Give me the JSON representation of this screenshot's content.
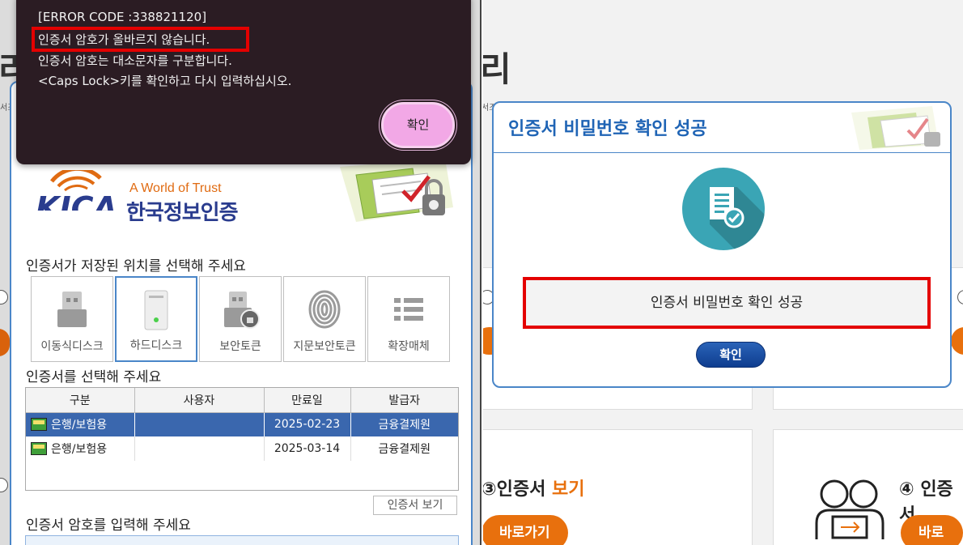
{
  "left": {
    "background": {
      "big_char": "리",
      "crumb": "서조"
    },
    "error_dialog": {
      "code_line": "[ERROR CODE :338821120]",
      "message_highlight": "인증서 암호가 올바르지 않습니다.",
      "message_2": "인증서 암호는 대소문자를 구분합니다.",
      "message_3": "<Caps Lock>키를 확인하고 다시 입력하십시오.",
      "ok_label": "확인"
    },
    "kica": {
      "logo_text": "KICA",
      "tagline": "A World of Trust",
      "name": "한국정보인증",
      "storage_title": "인증서가 저장된 위치를 선택해 주세요",
      "storage_options": [
        {
          "label": "이동식디스크",
          "icon": "usb-drive-icon",
          "selected": false
        },
        {
          "label": "하드디스크",
          "icon": "hard-disk-icon",
          "selected": true
        },
        {
          "label": "보안토큰",
          "icon": "security-token-icon",
          "selected": false
        },
        {
          "label": "지문보안토큰",
          "icon": "fingerprint-icon",
          "selected": false
        },
        {
          "label": "확장매체",
          "icon": "list-icon",
          "selected": false
        }
      ],
      "select_title": "인증서를 선택해 주세요",
      "table": {
        "headers": [
          "구분",
          "사용자",
          "만료일",
          "발급자"
        ],
        "rows": [
          {
            "type": "은행/보험용",
            "user": "",
            "expiry": "2025-02-23",
            "issuer": "금융결제원",
            "selected": true
          },
          {
            "type": "은행/보험용",
            "user": "",
            "expiry": "2025-03-14",
            "issuer": "금융결제원",
            "selected": false
          }
        ]
      },
      "view_cert_label": "인증서 보기",
      "password_title": "인증서 암호를 입력해 주세요"
    }
  },
  "right": {
    "background": {
      "big_char": "리",
      "crumb": "서조",
      "card3_num": "③",
      "card3_title_a": "인증서",
      "card3_title_b": "보기",
      "card4_num": "④",
      "card4_title": "인증서",
      "goto_label": "바로가기",
      "goto_label_2": "바로가"
    },
    "dialog": {
      "title": "인증서 비밀번호 확인 성공",
      "message": "인증서 비밀번호 확인 성공",
      "ok_label": "확인"
    }
  },
  "colors": {
    "dialog_border": "#4a86c8",
    "highlight": "#e40000",
    "accent_orange": "#e8700d",
    "kica_blue": "#2a3c8e",
    "selected_row": "#3a67ae",
    "error_bg": "#2b1c23",
    "error_ok": "#f2a8e6"
  }
}
